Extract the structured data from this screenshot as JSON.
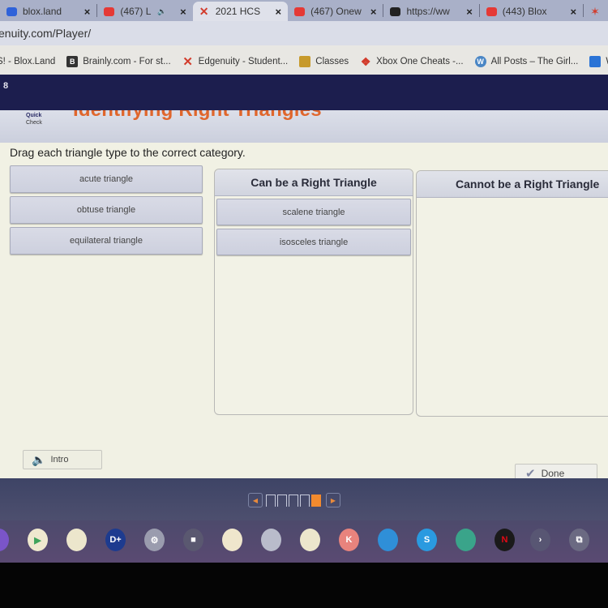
{
  "browser": {
    "tabs": [
      {
        "label": "blox.land",
        "icon": "blox-land-icon",
        "color": "#2f62d9",
        "active": false
      },
      {
        "label": "(467) L",
        "icon": "youtube-icon",
        "color": "#e53935",
        "active": false,
        "audio": true
      },
      {
        "label": "2021 HCS",
        "icon": "edgenuity-icon",
        "color": "#d23c2c",
        "active": true
      },
      {
        "label": "(467) Onew",
        "icon": "youtube-icon",
        "color": "#e53935",
        "active": false
      },
      {
        "label": "https://ww",
        "icon": "tiktok-icon",
        "color": "#222222",
        "active": false
      },
      {
        "label": "(443) Blox",
        "icon": "youtube-icon",
        "color": "#e53935",
        "active": false
      },
      {
        "label": "",
        "icon": "star-app-icon",
        "color": "#d23c2c",
        "active": false
      }
    ],
    "close_glyph": "×",
    "audio_glyph": "🔈",
    "url": "enuity.com/Player/",
    "bookmarks": [
      {
        "label": "S! - Blox.Land",
        "icon": "blox-land-icon"
      },
      {
        "label": "Brainly.com - For st...",
        "icon": "brainly-icon",
        "glyph": "B"
      },
      {
        "label": "Edgenuity - Student...",
        "icon": "edgenuity-icon"
      },
      {
        "label": "Classes",
        "icon": "classroom-icon"
      },
      {
        "label": "Xbox One Cheats -...",
        "icon": "cheats-icon"
      },
      {
        "label": "All Posts – The Girl...",
        "icon": "wordpress-icon",
        "glyph": "W"
      },
      {
        "label": "W",
        "icon": "bookmark-w-icon"
      }
    ]
  },
  "player": {
    "lesson_number": "8",
    "quick_check": [
      "Quick",
      "Check"
    ],
    "title": "Identifying Right Triangles",
    "title_color": "#e0662c",
    "instructions": "Drag each triangle type to the correct category.",
    "source_items": [
      "acute triangle",
      "obtuse triangle",
      "equilateral triangle"
    ],
    "bins": [
      {
        "title": "Can be a Right Triangle",
        "items": [
          "scalene triangle",
          "isosceles triangle"
        ]
      },
      {
        "title": "Cannot be a Right Triangle",
        "items": []
      }
    ],
    "intro_label": "Intro",
    "done_label": "Done",
    "pager": {
      "total": 5,
      "current": 5,
      "prev_glyph": "◀",
      "next_glyph": "▶",
      "accent": "#f28a2e"
    }
  },
  "shelf": {
    "apps": [
      {
        "name": "twitch-app-icon",
        "color": "#7a55c9",
        "glyph": ""
      },
      {
        "name": "play-store-app-icon",
        "color": "#efe8cf",
        "glyph": "▶"
      },
      {
        "name": "app-2-icon",
        "color": "#ece6cc",
        "glyph": ""
      },
      {
        "name": "disney-plus-app-icon",
        "color": "#1d3b8f",
        "glyph": "D+"
      },
      {
        "name": "settings-app-icon",
        "color": "#9a9cae",
        "glyph": "⚙"
      },
      {
        "name": "roblox-app-icon",
        "color": "#5a5870",
        "glyph": "■"
      },
      {
        "name": "app-face-icon",
        "color": "#efe6cc",
        "glyph": ""
      },
      {
        "name": "app-car-icon",
        "color": "#b9bccb",
        "glyph": ""
      },
      {
        "name": "app-docs-icon",
        "color": "#ece6cc",
        "glyph": ""
      },
      {
        "name": "app-k-icon",
        "color": "#e8837d",
        "glyph": "K"
      },
      {
        "name": "files-app-icon",
        "color": "#2f8fd8",
        "glyph": ""
      },
      {
        "name": "shazam-app-icon",
        "color": "#2a9ae0",
        "glyph": "S"
      },
      {
        "name": "app-photos-icon",
        "color": "#3aa48a",
        "glyph": ""
      },
      {
        "name": "netflix-app-icon",
        "color": "#1a1a1a",
        "glyph": "N"
      },
      {
        "name": "more-apps-icon",
        "color": "#585673",
        "glyph": "›"
      },
      {
        "name": "overview-icon",
        "color": "#6b6a82",
        "glyph": "⧉"
      }
    ]
  }
}
